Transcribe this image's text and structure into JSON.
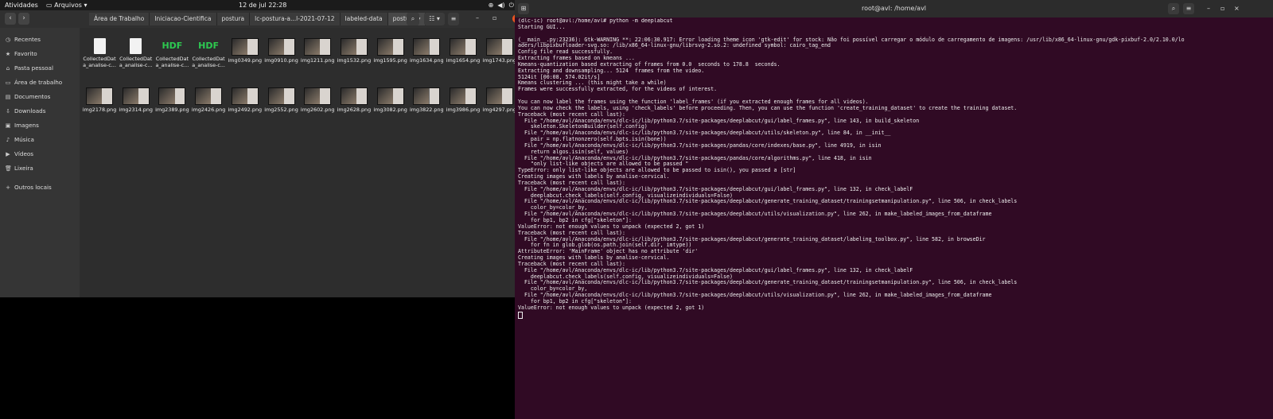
{
  "topbar": {
    "activities": "Atividades",
    "app": "Arquivos",
    "clock": "12 de jul  22:28",
    "tray": [
      "⊕",
      "◀)",
      "⏻",
      "▾"
    ]
  },
  "file_manager": {
    "breadcrumbs": [
      "Área de Trabalho",
      "Iniciacao-Cientifica",
      "postura",
      "lc-postura-a...l-2021-07-12",
      "labeled-data",
      "postura"
    ],
    "sidebar": [
      {
        "icon": "clock-icon",
        "glyph": "◷",
        "label": "Recentes"
      },
      {
        "icon": "star-icon",
        "glyph": "★",
        "label": "Favorito"
      },
      {
        "icon": "home-icon",
        "glyph": "⌂",
        "label": "Pasta pessoal"
      },
      {
        "icon": "desktop-icon",
        "glyph": "▭",
        "label": "Área de trabalho"
      },
      {
        "icon": "document-icon",
        "glyph": "▤",
        "label": "Documentos"
      },
      {
        "icon": "download-icon",
        "glyph": "⇩",
        "label": "Downloads"
      },
      {
        "icon": "image-icon",
        "glyph": "▣",
        "label": "Imagens"
      },
      {
        "icon": "music-icon",
        "glyph": "♪",
        "label": "Música"
      },
      {
        "icon": "video-icon",
        "glyph": "▶",
        "label": "Vídeos"
      },
      {
        "icon": "trash-icon",
        "glyph": "🗑",
        "label": "Lixeira"
      },
      {
        "icon": "plus-icon",
        "glyph": "+",
        "label": "Outros locais"
      }
    ],
    "files": [
      {
        "type": "doc",
        "name": "CollectedData_analise-c..."
      },
      {
        "type": "doc",
        "name": "CollectedData_analise-c..."
      },
      {
        "type": "hdf",
        "name": "CollectedData_analise-c..."
      },
      {
        "type": "hdf",
        "name": "CollectedData_analise-c..."
      },
      {
        "type": "img",
        "name": "img0349.png"
      },
      {
        "type": "img",
        "name": "img0910.png"
      },
      {
        "type": "img",
        "name": "img1211.png"
      },
      {
        "type": "img",
        "name": "img1532.png"
      },
      {
        "type": "img",
        "name": "img1595.png"
      },
      {
        "type": "img",
        "name": "img1634.png"
      },
      {
        "type": "img",
        "name": "img1654.png"
      },
      {
        "type": "img",
        "name": "img1743.png"
      },
      {
        "type": "img",
        "name": "img2178.png"
      },
      {
        "type": "img",
        "name": "img2314.png"
      },
      {
        "type": "img",
        "name": "img2389.png"
      },
      {
        "type": "img",
        "name": "img2426.png"
      },
      {
        "type": "img",
        "name": "img2492.png"
      },
      {
        "type": "img",
        "name": "img2552.png"
      },
      {
        "type": "img",
        "name": "img2602.png"
      },
      {
        "type": "img",
        "name": "img2628.png"
      },
      {
        "type": "img",
        "name": "img3082.png"
      },
      {
        "type": "img",
        "name": "img3822.png"
      },
      {
        "type": "img",
        "name": "img3986.png"
      },
      {
        "type": "img",
        "name": "img4297.png"
      }
    ]
  },
  "terminal": {
    "title": "root@avl: /home/avl",
    "lines": [
      "(dlc-ic) root@avl:/home/avl# python -m deeplabcut",
      "Starting GUI...",
      "",
      "(__main__.py:23236): Gtk-WARNING **: 22:06:30.917: Error loading theme icon 'gtk-edit' for stock: Não foi possível carregar o módulo de carregamento de imagens: /usr/lib/x86_64-linux-gnu/gdk-pixbuf-2.0/2.10.0/lo",
      "aders/libpixbufloader-svg.so: /lib/x86_64-linux-gnu/librsvg-2.so.2: undefined symbol: cairo_tag_end",
      "Config file read successfully.",
      "Extracting frames based on kmeans ...",
      "Kmeans-quantization based extracting of frames from 0.0  seconds to 178.8  seconds.",
      "Extracting and downsampling... 5124  frames from the video.",
      "5124it [00:08, 574.02it/s]",
      "Kmeans clustering ... (this might take a while)",
      "Frames were successfully extracted, for the videos of interest.",
      "",
      "You can now label the frames using the function 'label_frames' (if you extracted enough frames for all videos).",
      "You can now check the labels, using 'check_labels' before proceeding. Then, you can use the function 'create_training_dataset' to create the training dataset.",
      "Traceback (most recent call last):",
      "  File \"/home/avl/Anaconda/envs/dlc-ic/lib/python3.7/site-packages/deeplabcut/gui/label_frames.py\", line 143, in build_skeleton",
      "    skeleton.SkeletonBuilder(self.config)",
      "  File \"/home/avl/Anaconda/envs/dlc-ic/lib/python3.7/site-packages/deeplabcut/utils/skeleton.py\", line 84, in __init__",
      "    pair = np.flatnonzero(self.bpts.isin(bone))",
      "  File \"/home/avl/Anaconda/envs/dlc-ic/lib/python3.7/site-packages/pandas/core/indexes/base.py\", line 4919, in isin",
      "    return algos.isin(self, values)",
      "  File \"/home/avl/Anaconda/envs/dlc-ic/lib/python3.7/site-packages/pandas/core/algorithms.py\", line 418, in isin",
      "    \"only list-like objects are allowed to be passed \"",
      "TypeError: only list-like objects are allowed to be passed to isin(), you passed a [str]",
      "Creating images with labels by analise-cervical.",
      "Traceback (most recent call last):",
      "  File \"/home/avl/Anaconda/envs/dlc-ic/lib/python3.7/site-packages/deeplabcut/gui/label_frames.py\", line 132, in check_labelF",
      "    deeplabcut.check_labels(self.config, visualizeindividuals=False)",
      "  File \"/home/avl/Anaconda/envs/dlc-ic/lib/python3.7/site-packages/deeplabcut/generate_training_dataset/trainingsetmanipulation.py\", line 506, in check_labels",
      "    color_by=color_by,",
      "  File \"/home/avl/Anaconda/envs/dlc-ic/lib/python3.7/site-packages/deeplabcut/utils/visualization.py\", line 262, in make_labeled_images_from_dataframe",
      "    for bp1, bp2 in cfg[\"skeleton\"]:",
      "ValueError: not enough values to unpack (expected 2, got 1)",
      "Traceback (most recent call last):",
      "  File \"/home/avl/Anaconda/envs/dlc-ic/lib/python3.7/site-packages/deeplabcut/generate_training_dataset/labeling_toolbox.py\", line 582, in browseDir",
      "    for fn in glob.glob(os.path.join(self.dir, imtype))",
      "AttributeError: 'MainFrame' object has no attribute 'dir'",
      "Creating images with labels by analise-cervical.",
      "Traceback (most recent call last):",
      "  File \"/home/avl/Anaconda/envs/dlc-ic/lib/python3.7/site-packages/deeplabcut/gui/label_frames.py\", line 132, in check_labelF",
      "    deeplabcut.check_labels(self.config, visualizeindividuals=False)",
      "  File \"/home/avl/Anaconda/envs/dlc-ic/lib/python3.7/site-packages/deeplabcut/generate_training_dataset/trainingsetmanipulation.py\", line 506, in check_labels",
      "    color_by=color_by,",
      "  File \"/home/avl/Anaconda/envs/dlc-ic/lib/python3.7/site-packages/deeplabcut/utils/visualization.py\", line 262, in make_labeled_images_from_dataframe",
      "    for bp1, bp2 in cfg[\"skeleton\"]:",
      "ValueError: not enough values to unpack (expected 2, got 1)"
    ]
  }
}
